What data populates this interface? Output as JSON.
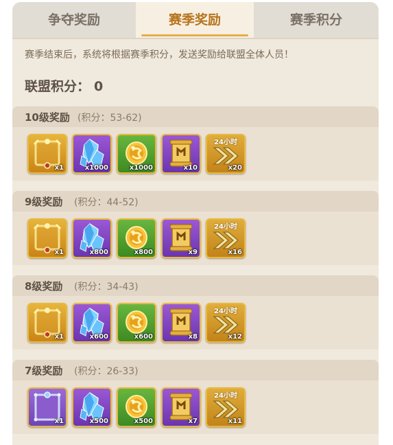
{
  "tabs": [
    {
      "label": "争夺奖励",
      "active": false
    },
    {
      "label": "赛季奖励",
      "active": true
    },
    {
      "label": "赛季积分",
      "active": false
    }
  ],
  "notice": "赛季结束后，系统将根据赛季积分，发送奖励给联盟全体人员！",
  "alliance_score": {
    "label": "联盟积分：",
    "value": "0"
  },
  "tiers": [
    {
      "title": "10级奖励",
      "range": "(积分：53-62)",
      "items": [
        {
          "icon": "frame-gold-icon",
          "qty": "x1"
        },
        {
          "icon": "crystal-icon",
          "qty": "x1000"
        },
        {
          "icon": "gold-coin-icon",
          "qty": "x1000"
        },
        {
          "icon": "scroll-icon",
          "qty": "x10"
        },
        {
          "icon": "speedup-24h-icon",
          "qty": "x20",
          "label": "24小时"
        }
      ]
    },
    {
      "title": "9级奖励",
      "range": "(积分：44-52)",
      "items": [
        {
          "icon": "frame-gold-icon",
          "qty": "x1"
        },
        {
          "icon": "crystal-icon",
          "qty": "x800"
        },
        {
          "icon": "gold-coin-icon",
          "qty": "x800"
        },
        {
          "icon": "scroll-icon",
          "qty": "x9"
        },
        {
          "icon": "speedup-24h-icon",
          "qty": "x16",
          "label": "24小时"
        }
      ]
    },
    {
      "title": "8级奖励",
      "range": "(积分：34-43)",
      "items": [
        {
          "icon": "frame-gold-icon",
          "qty": "x1"
        },
        {
          "icon": "crystal-icon",
          "qty": "x600"
        },
        {
          "icon": "gold-coin-icon",
          "qty": "x600"
        },
        {
          "icon": "scroll-icon",
          "qty": "x8"
        },
        {
          "icon": "speedup-24h-icon",
          "qty": "x12",
          "label": "24小时"
        }
      ]
    },
    {
      "title": "7级奖励",
      "range": "(积分：26-33)",
      "items": [
        {
          "icon": "frame-purple-icon",
          "qty": "x1"
        },
        {
          "icon": "crystal-icon",
          "qty": "x500"
        },
        {
          "icon": "gold-coin-icon",
          "qty": "x500"
        },
        {
          "icon": "scroll-icon",
          "qty": "x7"
        },
        {
          "icon": "speedup-24h-icon",
          "qty": "x11",
          "label": "24小时"
        }
      ]
    }
  ]
}
